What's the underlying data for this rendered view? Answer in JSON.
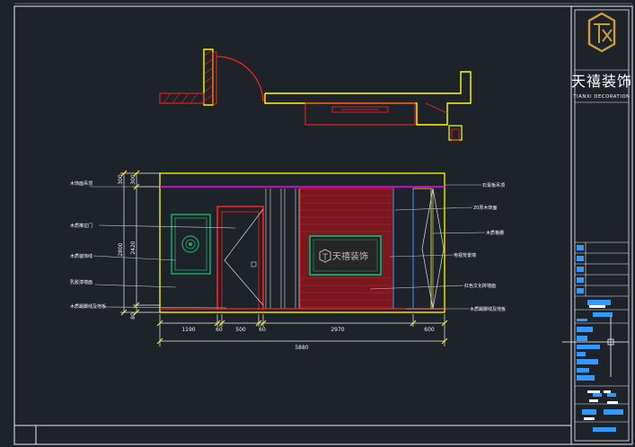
{
  "colors": {
    "background": "#1e2329",
    "frame": "#e9e9e9",
    "wall": "#ffff00",
    "door": "#ff2020",
    "dim": "#f0f0f0",
    "leader": "#c8c8c8",
    "tv_frame": "#1aa86a",
    "brick_red": "#8c1c24",
    "magenta": "#ff00ff",
    "cyan": "#3399ff",
    "logo_gold": "#c89b3c"
  },
  "icons": {
    "logo": "tianxi-logo-icon",
    "tv_logo": "tianxi-tv-logo-icon",
    "door_medallion": "medallion-icon",
    "crosshair": "crosshair-icon"
  },
  "title_block": {
    "brand_cn": "天禧装饰",
    "brand_en": "TIANXI DECORATION"
  },
  "tv_logo_text": "天禧装饰",
  "dimensions": {
    "bottom_segments": [
      "1190",
      "60",
      "500",
      "60",
      "2970",
      "600"
    ],
    "bottom_total": "5880",
    "left_outer": "2800",
    "left_inner": [
      "300",
      "2420",
      "80"
    ],
    "left_inner2": [
      "300"
    ]
  },
  "left_labels": [
    "木饰面吊顶",
    "木质推拉门",
    "木质装饰线",
    "乳胶漆墙面",
    "木质踢脚线及地板"
  ],
  "right_labels": [
    "石膏板吊顶",
    "20厚木饰面",
    "木质格栅",
    "电视背景墙",
    "红色文化砖墙面",
    "木质踢脚线及地板"
  ]
}
